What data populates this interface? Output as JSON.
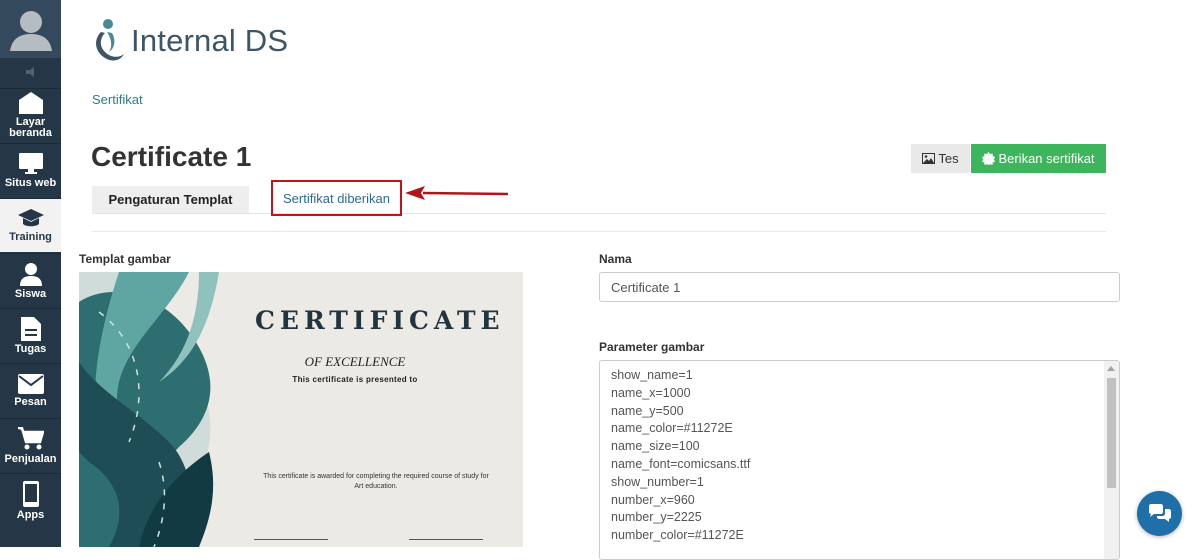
{
  "sidebar": {
    "items": [
      {
        "label": "Layar beranda",
        "icon": "home-icon"
      },
      {
        "label": "Situs web",
        "icon": "monitor-icon"
      },
      {
        "label": "Training",
        "icon": "graduation-cap-icon"
      },
      {
        "label": "Siswa",
        "icon": "user-icon"
      },
      {
        "label": "Tugas",
        "icon": "document-icon"
      },
      {
        "label": "Pesan",
        "icon": "envelope-icon"
      },
      {
        "label": "Penjualan",
        "icon": "cart-icon"
      },
      {
        "label": "Apps",
        "icon": "phone-icon"
      }
    ],
    "active_item": "Training"
  },
  "logo": {
    "text": "Internal DS"
  },
  "breadcrumb": "Sertifikat",
  "page_title": "Certificate 1",
  "actions": {
    "test_label": "Tes",
    "give_label": "Berikan sertifikat"
  },
  "tabs": [
    {
      "label": "Pengaturan Templat"
    },
    {
      "label": "Sertifikat diberikan"
    }
  ],
  "template": {
    "label": "Templat gambar",
    "cert_title": "CERTIFICATE",
    "cert_subtitle": "OF EXCELLENCE",
    "cert_presented": "This certificate is presented to",
    "cert_body": "This certificate is awarded for completing the required course of study for Art education."
  },
  "form": {
    "name_label": "Nama",
    "name_value": "Certificate 1",
    "params_label": "Parameter gambar",
    "params_lines": [
      "show_name=1",
      "name_x=1000",
      "name_y=500",
      "name_color=#11272E",
      "name_size=100",
      "name_font=comicsans.ttf",
      "show_number=1",
      "number_x=960",
      "number_y=2225",
      "number_color=#11272E"
    ]
  },
  "colors": {
    "sidebar": "#253746",
    "accent_green": "#3cb55c",
    "highlight_red": "#c0141b",
    "link": "#2c7f87"
  }
}
